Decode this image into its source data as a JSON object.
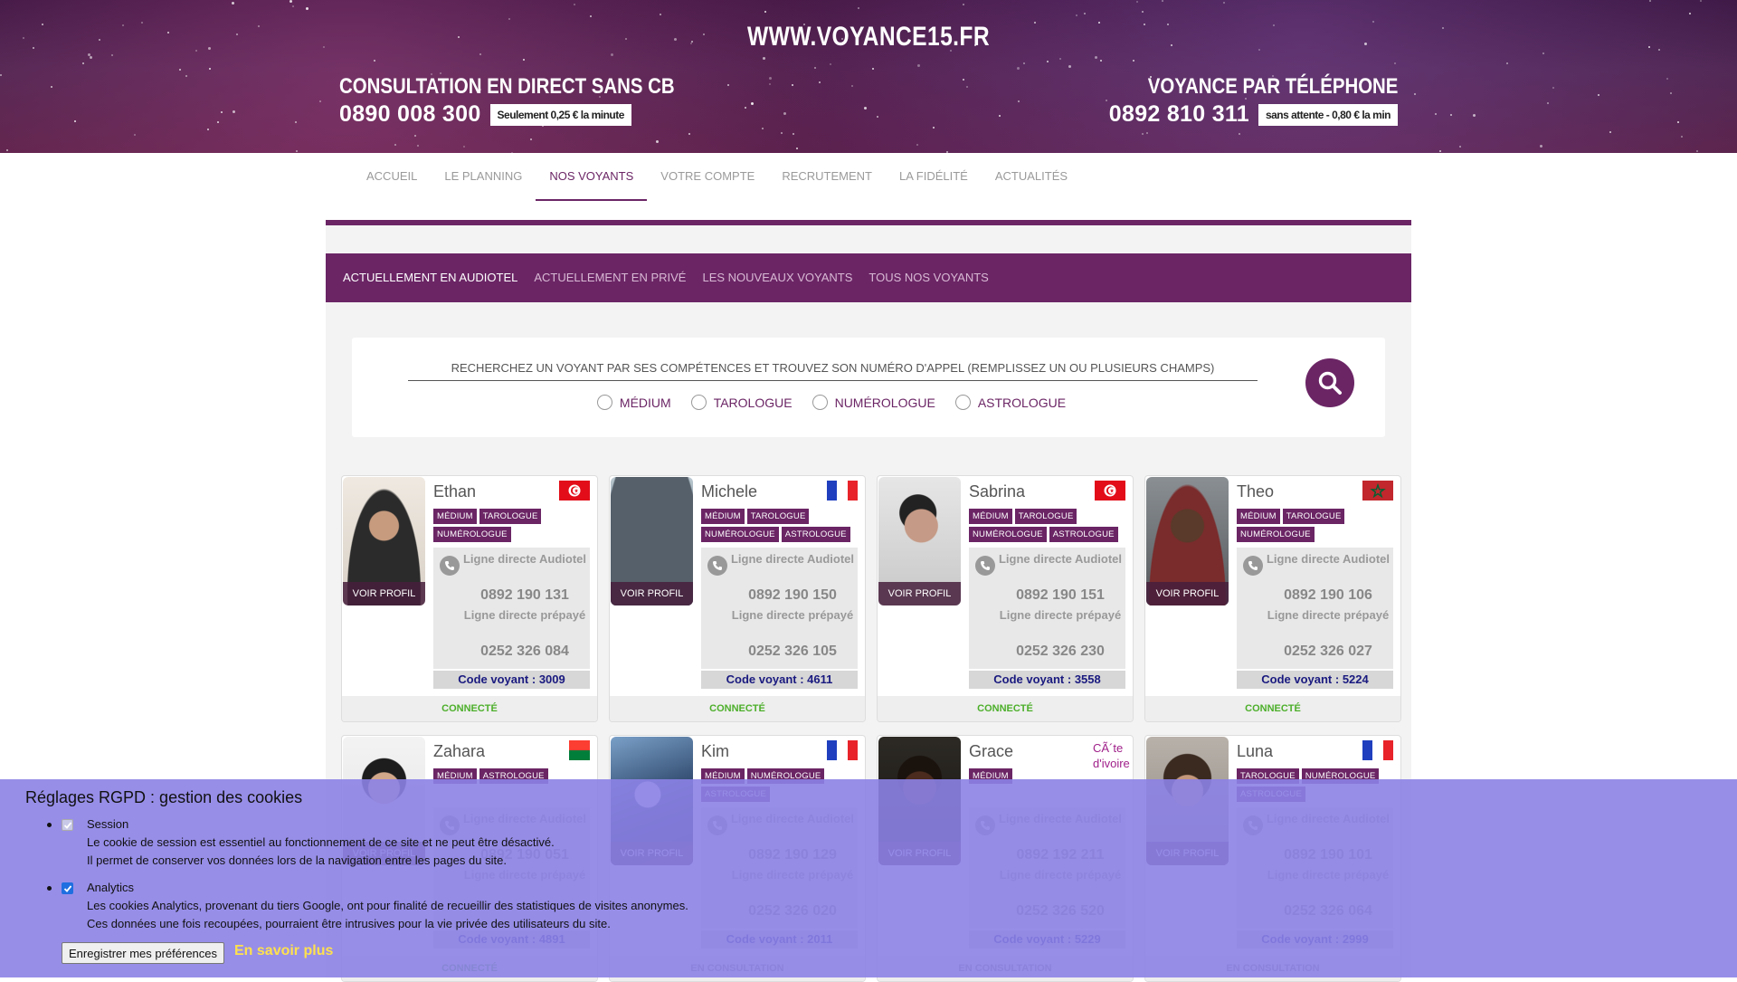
{
  "header": {
    "site_title": "WWW.VOYANCE15.FR",
    "left": {
      "heading": "CONSULTATION EN DIRECT SANS CB",
      "phone": "0890 008 300",
      "badge": "Seulement 0,25 € la minute"
    },
    "right": {
      "heading": "VOYANCE PAR TÉLÉPHONE",
      "phone": "0892 810 311",
      "badge": "sans attente - 0,80 € la min"
    }
  },
  "nav": [
    {
      "label": "ACCUEIL"
    },
    {
      "label": "LE PLANNING"
    },
    {
      "label": "NOS VOYANTS",
      "active": true
    },
    {
      "label": "VOTRE COMPTE"
    },
    {
      "label": "RECRUTEMENT"
    },
    {
      "label": "LA FIDÉLITÉ"
    },
    {
      "label": "ACTUALITÉS"
    }
  ],
  "subnav": [
    {
      "label": "ACTUELLEMENT EN AUDIOTEL",
      "active": true
    },
    {
      "label": "ACTUELLEMENT EN PRIVÉ"
    },
    {
      "label": "LES NOUVEAUX VOYANTS"
    },
    {
      "label": "TOUS NOS VOYANTS"
    }
  ],
  "search": {
    "placeholder": "RECHERCHEZ UN VOYANT PAR SES COMPÉTENCES ET TROUVEZ SON NUMÉRO D'APPEL (REMPLISSEZ UN OU PLUSIEURS CHAMPS)",
    "options": [
      "MÉDIUM",
      "TAROLOGUE",
      "NUMÉROLOGUE",
      "ASTROLOGUE"
    ]
  },
  "labels": {
    "voir_profil": "VOIR PROFIL",
    "ligne_audiotel": "Ligne directe Audiotel",
    "ligne_prepaye": "Ligne directe prépayé"
  },
  "voyants": [
    {
      "name": "Ethan",
      "flag": "tunisia",
      "tags": [
        "MÉDIUM",
        "TAROLOGUE",
        "NUMÉROLOGUE"
      ],
      "audiotel": "0892 190 131",
      "prepaye": "0252 326 084",
      "code": "Code voyant : 3009",
      "status": "CONNECTÉ"
    },
    {
      "name": "Michele",
      "flag": "france",
      "tags": [
        "MÉDIUM",
        "TAROLOGUE",
        "NUMÉROLOGUE",
        "ASTROLOGUE"
      ],
      "audiotel": "0892 190 150",
      "prepaye": "0252 326 105",
      "code": "Code voyant : 4611",
      "status": "CONNECTÉ"
    },
    {
      "name": "Sabrina",
      "flag": "tunisia",
      "tags": [
        "MÉDIUM",
        "TAROLOGUE",
        "NUMÉROLOGUE",
        "ASTROLOGUE"
      ],
      "audiotel": "0892 190 151",
      "prepaye": "0252 326 230",
      "code": "Code voyant : 3558",
      "status": "CONNECTÉ"
    },
    {
      "name": "Theo",
      "flag": "morocco",
      "tags": [
        "MÉDIUM",
        "TAROLOGUE",
        "NUMÉROLOGUE"
      ],
      "audiotel": "0892 190 106",
      "prepaye": "0252 326 027",
      "code": "Code voyant : 5224",
      "status": "CONNECTÉ"
    },
    {
      "name": "Zahara",
      "flag": "madagascar",
      "tags": [
        "MÉDIUM",
        "ASTROLOGUE"
      ],
      "audiotel": "0892 190 051",
      "prepaye": "",
      "code": "Code voyant : 4891",
      "status": "CONNECTÉ"
    },
    {
      "name": "Kim",
      "flag": "france",
      "tags": [
        "MÉDIUM",
        "NUMÉROLOGUE",
        "ASTROLOGUE"
      ],
      "audiotel": "0892 190 129",
      "prepaye": "0252 326 020",
      "code": "Code voyant : 2011",
      "status": "EN CONSULTATION"
    },
    {
      "name": "Grace",
      "flag": "text",
      "flag_text": "CÃ´te d'ivoire",
      "tags": [
        "MÉDIUM"
      ],
      "audiotel": "0892 192 211",
      "prepaye": "0252 326 520",
      "code": "Code voyant : 5229",
      "status": "EN CONSULTATION"
    },
    {
      "name": "Luna",
      "flag": "france",
      "tags": [
        "TAROLOGUE",
        "NUMÉROLOGUE",
        "ASTROLOGUE"
      ],
      "audiotel": "0892 190 101",
      "prepaye": "0252 326 064",
      "code": "Code voyant : 2999",
      "status": "EN CONSULTATION"
    }
  ],
  "cookie": {
    "title": "Réglages RGPD : gestion des cookies",
    "items": [
      {
        "name": "Session",
        "checked": true,
        "disabled": true,
        "line1": "Le cookie de session est essentiel au fonctionnement de ce site et ne peut être désactivé.",
        "line2": "Il permet de conserver vos données lors de la navigation entre les pages du site."
      },
      {
        "name": "Analytics",
        "checked": true,
        "disabled": false,
        "line1": "Les cookies Analytics, provenant du tiers Google, ont pour finalité de recueillir des statistiques de visites anonymes.",
        "line2": "Ces données une fois recoupées, pourraient être intrusives pour la vie privée des utilisateurs du site."
      }
    ],
    "save_label": "Enregistrer mes préférences",
    "more_label": "En savoir plus"
  },
  "colors": {
    "brand": "#6b2565",
    "connected": "#4caf2a",
    "cookie_bg": "#8c82e6",
    "link": "#ffe14d"
  }
}
